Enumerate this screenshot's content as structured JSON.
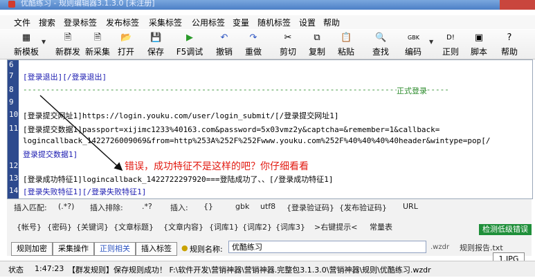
{
  "window": {
    "title": "优酷练习 - 规则编辑器3.1.3.0 [未注册]"
  },
  "menu": [
    "文件",
    "搜索",
    "登录标签",
    "发布标签",
    "采集标签",
    "公用标签",
    "变量",
    "随机标签",
    "设置",
    "帮助"
  ],
  "toolbar": [
    {
      "label": "新模板",
      "icon": "▦"
    },
    {
      "label": "新群发",
      "icon": "🗎"
    },
    {
      "label": "新采集",
      "icon": "🗎"
    },
    {
      "label": "打开",
      "icon": "📂"
    },
    {
      "label": "保存",
      "icon": "💾"
    },
    {
      "label": "F5调试",
      "icon": "▶"
    },
    {
      "label": "撤销",
      "icon": "↶"
    },
    {
      "label": "重做",
      "icon": "↷"
    },
    {
      "label": "剪切",
      "icon": "✂"
    },
    {
      "label": "复制",
      "icon": "⧉"
    },
    {
      "label": "粘贴",
      "icon": "📋"
    },
    {
      "label": "查找",
      "icon": "🔍"
    },
    {
      "label": "编码",
      "icon": "GBK"
    },
    {
      "label": "正则",
      "icon": "D!"
    },
    {
      "label": "脚本",
      "icon": "▣"
    },
    {
      "label": "帮助",
      "icon": "?"
    }
  ],
  "editor": {
    "line_numbers": [
      "6",
      "7",
      "8",
      "9",
      "10",
      "11",
      "",
      "",
      "12",
      "13",
      "14"
    ],
    "lines": {
      "l7": "[登录退出][/登录退出]",
      "l8_dash": "---------------------------------------------------------------------------------------------",
      "l8_label": "正式登录",
      "l10": "[登录提交网址1]https://login.youku.com/user/login_submit/[/登录提交网址1]",
      "l11a": "[登录提交数据1]passport=xijimc1233%40163.com&password=5x03vmz2y&captcha=&remember=1&callback=",
      "l11b": "logincallback_1422726009069&from=http%253A%252F%252Fwww.youku.com%252F%40%40%40%40header&wintype=pop[/",
      "l11c": "登录提交数据1]",
      "l13": "[登录成功特征1]logincallback_1422722297920===登陆成功了、、[/登录成功特征1]",
      "l14": "[登录失败特征1][/登录失败特征1]"
    },
    "annotation": "错误，成功特征不是这样的吧？你仔细看看"
  },
  "panel": {
    "row1": [
      "插入匹配:",
      "(.*?)",
      "插入排除:",
      ".*?",
      "插入:",
      "{}",
      "gbk",
      "utf8",
      "{登录验证码}",
      "{发布验证码}",
      "URL"
    ],
    "row2": [
      "{帐号}",
      "{密码}",
      "{关键词}",
      "{文章标题}",
      "{文章内容}",
      "{词库1}",
      "{词库2}",
      "{词库3}",
      ">右键提示<",
      "常量表"
    ],
    "detect_button": "检测低级错误",
    "tabs": [
      "规则加密",
      "采集操作",
      "正则相关",
      "插入标签"
    ],
    "name_label": "规则名称:",
    "name_value": "优酷练习",
    "ext": ".wzdr",
    "report": "规则报告.txt"
  },
  "status": {
    "label": "状态",
    "time": "1:47:23",
    "message": "【群发规则】保存规则成功！ F:\\软件开发\\营销神器\\营销神器.完整包3.1.3.0\\营销神器\\规则\\优酷练习.wzdr"
  },
  "overlay_badge": "1.JPG"
}
